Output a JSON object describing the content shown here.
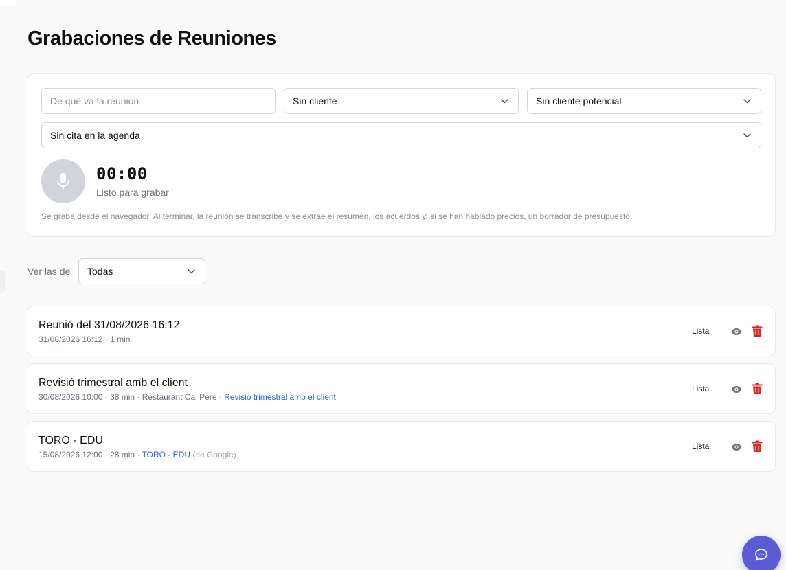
{
  "page": {
    "title": "Grabaciones de Reuniones"
  },
  "recorder": {
    "topic_placeholder": "De qué va la reunión",
    "client_value": "Sin cliente",
    "lead_value": "Sin cliente potencial",
    "appointment_value": "Sin cita en la agenda",
    "timer": "00:00",
    "status": "Listo para grabar",
    "note": "Se graba desde el navegador. Al terminar, la reunión se transcribe y se extrae el resumen, los acuerdos y, si se han hablado precios, un borrador de presupuesto."
  },
  "filter": {
    "label": "Ver las de",
    "value": "Todas"
  },
  "meetings": [
    {
      "title": "Reunió del 31/08/2026 16:12",
      "meta": "31/08/2026 16:12 · 1 min",
      "status": "Lista"
    },
    {
      "title": "Revisió trimestral amb el client",
      "meta": "30/08/2026 10:00 · 38 min · Restaurant Cal Pere · ",
      "link": "Revisió trimestral amb el client",
      "status": "Lista"
    },
    {
      "title": "TORO - EDU",
      "meta": "15/08/2026 12:00 · 28 min · ",
      "link": "TORO - EDU",
      "source": " (de Google)",
      "status": "Lista"
    }
  ],
  "colors": {
    "accent": "#5b5bd6",
    "link": "#2563eb",
    "danger": "#dc2626",
    "mic_bg": "#d1d5db"
  },
  "icons": {
    "mic": "microphone-icon",
    "chevron": "chevron-down-icon",
    "view": "eye-icon",
    "delete": "trash-icon",
    "chat": "chat-icon"
  }
}
